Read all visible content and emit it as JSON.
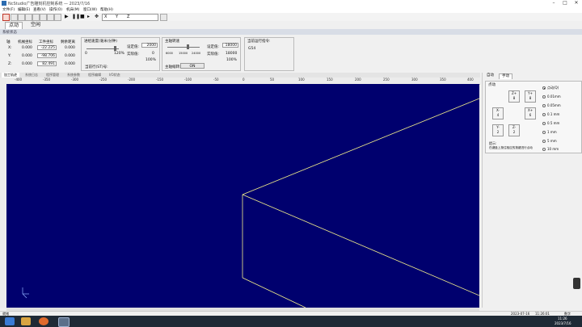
{
  "window": {
    "title": "NcStudio广告雕刻机控制系统 — 2023/7/16"
  },
  "menu": [
    "文件(F)",
    "编辑(E)",
    "查看(V)",
    "操作(O)",
    "机床(M)",
    "窗口(W)",
    "帮助(H)"
  ],
  "toolbar": {
    "coord_labels": [
      "X",
      "Y",
      "Z"
    ]
  },
  "main_tabs": [
    {
      "label": "点动",
      "selected": true
    },
    {
      "label": "空闲",
      "selected": false
    }
  ],
  "status": {
    "section_title": "系统状态",
    "axis_header": "轴",
    "col_machine": "机械坐标",
    "col_work": "工件坐标",
    "col_remain": "剩余距离",
    "axes": [
      {
        "name": "X:",
        "machine": "0.000",
        "work": "-22.225",
        "remain": "0.000"
      },
      {
        "name": "Y:",
        "machine": "0.000",
        "work": "-98.706",
        "remain": "0.000"
      },
      {
        "name": "Z:",
        "machine": "0.000",
        "work": "82.491",
        "remain": "0.000"
      }
    ],
    "feed": {
      "title": "进给速度(毫米/分钟)",
      "set_label": "设定值:",
      "set_value": "2000",
      "actual_label": "实际值:",
      "actual_value": "0",
      "percent": "100%",
      "min": "0",
      "max": "120%",
      "current_label": "当前行(ST)号:"
    },
    "spindle": {
      "title": "主轴转速",
      "set_label": "设定值:",
      "set_value": "18000",
      "actual_label": "实际值:",
      "actual_value": "18000",
      "percent": "100%",
      "ticks": [
        "6000",
        "15000",
        "24000"
      ],
      "toggle_label": "主轴缩转:",
      "toggle_value": "ON"
    },
    "command": {
      "title": "当前运行指令:",
      "value": "G54"
    }
  },
  "view_tabs": [
    "加工轨迹",
    "系统日志",
    "程序管理",
    "系统参数",
    "程序编辑",
    "I/O状态"
  ],
  "ruler_ticks": [
    "-400",
    "-350",
    "-300",
    "-250",
    "-200",
    "-150",
    "-100",
    "-50",
    "0",
    "50",
    "100",
    "150",
    "200",
    "250",
    "300",
    "350",
    "400"
  ],
  "right_panel": {
    "tabs": [
      {
        "label": "自动",
        "selected": false
      },
      {
        "label": "手动",
        "selected": true
      }
    ],
    "group_title": "点动",
    "jog_buttons": [
      {
        "label": "Z+",
        "key": "8"
      },
      {
        "label": "X-",
        "key": "4"
      },
      {
        "label": "X+",
        "key": "6"
      },
      {
        "label": "Y+",
        "key": "8"
      },
      {
        "label": "Y-",
        "key": "2"
      },
      {
        "label": "Z-",
        "key": "2"
      }
    ],
    "step_options": [
      {
        "label": "点动(Q)",
        "selected": true
      },
      {
        "label": "0.01mm",
        "selected": false
      },
      {
        "label": "0.05mm",
        "selected": false
      },
      {
        "label": "0.1 mm",
        "selected": false
      },
      {
        "label": "0.5 mm",
        "selected": false
      },
      {
        "label": "1   mm",
        "selected": false
      },
      {
        "label": "5   mm",
        "selected": false
      },
      {
        "label": "10  mm",
        "selected": false
      }
    ],
    "hint_title": "提示:",
    "hint_text": "在键盘上按住相应的按键进行点动"
  },
  "statusbar": {
    "left": "就绪",
    "date": "2023-07-16",
    "time": "11:26:01",
    "mode": "数字"
  },
  "taskbar": {
    "time": "11:26",
    "date": "2023/7/16"
  },
  "colors": {
    "canvas": "#00006e",
    "path": "#f4f08a",
    "taskbar": "#1f2a36"
  }
}
